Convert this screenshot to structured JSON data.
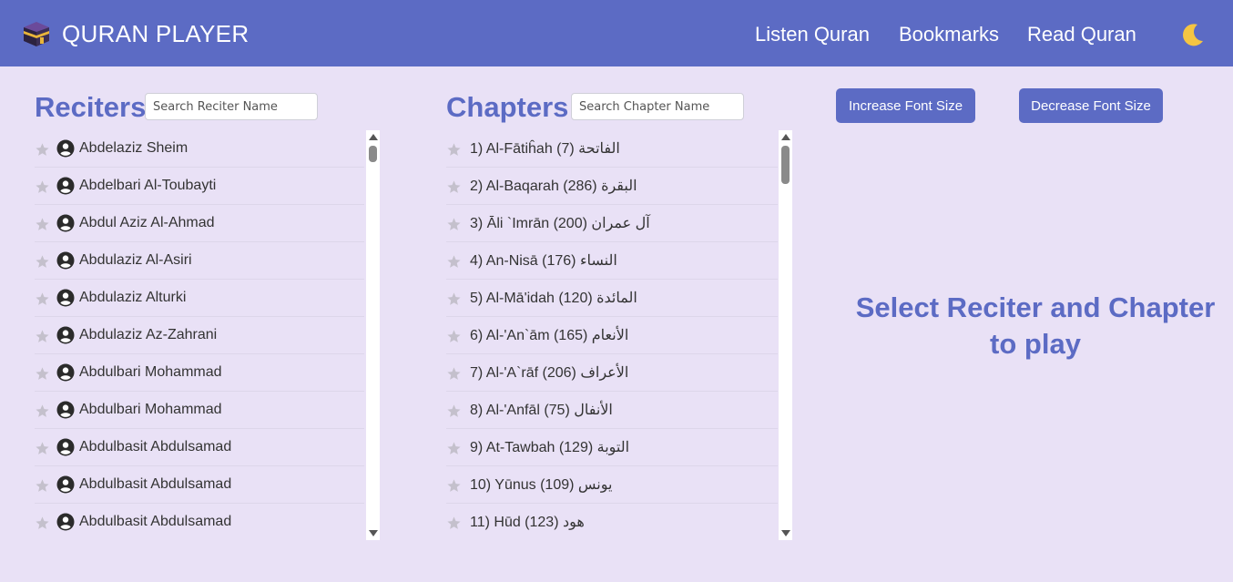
{
  "navbar": {
    "title": "QURAN PLAYER",
    "links": [
      "Listen Quran",
      "Bookmarks",
      "Read Quran"
    ],
    "theme_icon": "moon-icon"
  },
  "reciters": {
    "title": "Reciters",
    "search_placeholder": "Search Reciter Name",
    "items": [
      "Abdelaziz Sheim",
      "Abdelbari Al-Toubayti",
      "Abdul Aziz Al-Ahmad",
      "Abdulaziz Al-Asiri",
      "Abdulaziz Alturki",
      "Abdulaziz Az-Zahrani",
      "Abdulbari Mohammad",
      "Abdulbari Mohammad",
      "Abdulbasit Abdulsamad",
      "Abdulbasit Abdulsamad",
      "Abdulbasit Abdulsamad"
    ]
  },
  "chapters": {
    "title": "Chapters",
    "search_placeholder": "Search Chapter Name",
    "items": [
      "1) Al-Fātiĥah (7) الفاتحة",
      "2) Al-Baqarah (286) البقرة",
      "3) Āli `Imrān (200) آل عمران",
      "4) An-Nisā (176) النساء",
      "5) Al-Mā'idah (120) المائدة",
      "6) Al-'An`ām (165) الأنعام",
      "7) Al-'A`rāf (206) الأعراف",
      "8) Al-'Anfāl (75) الأنفال",
      "9) At-Tawbah (129) التوبة",
      "10) Yūnus (109) يونس",
      "11) Hūd (123) هود"
    ]
  },
  "controls": {
    "increase_label": "Increase Font Size",
    "decrease_label": "Decrease Font Size"
  },
  "prompt": {
    "line1": "Select Reciter and Chapter",
    "line2": "to play"
  },
  "colors": {
    "primary": "#5c6bc4",
    "background": "#e9e1f6"
  }
}
